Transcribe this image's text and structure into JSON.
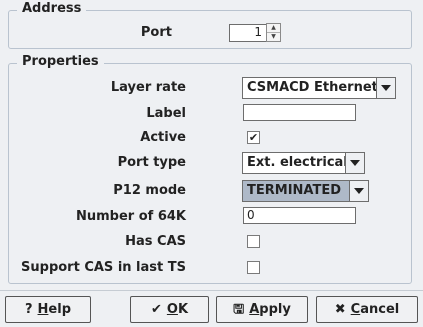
{
  "address": {
    "title": "Address",
    "port_label": "Port",
    "port_value": "1"
  },
  "properties": {
    "title": "Properties",
    "layer_rate": {
      "label": "Layer rate",
      "value": "CSMACD Ethernet"
    },
    "label": {
      "label": "Label",
      "value": ""
    },
    "active": {
      "label": "Active",
      "checked": true,
      "mark": "✔"
    },
    "port_type": {
      "label": "Port type",
      "value": "Ext. electrical"
    },
    "p12_mode": {
      "label": "P12 mode",
      "value": "TERMINATED"
    },
    "number_of_64k": {
      "label": "Number of 64K",
      "value": "0"
    },
    "has_cas": {
      "label": "Has CAS",
      "checked": false
    },
    "support_cas_last_ts": {
      "label": "Support CAS in last TS",
      "checked": false
    }
  },
  "buttons": {
    "help": {
      "icon": "?",
      "mnemonic": "H",
      "rest": "elp"
    },
    "ok": {
      "icon": "✔",
      "mnemonic": "O",
      "rest": "K"
    },
    "apply": {
      "icon": "🖫",
      "mnemonic": "A",
      "rest": "pply"
    },
    "cancel": {
      "icon": "✖",
      "mnemonic": "C",
      "rest": "ancel"
    }
  }
}
